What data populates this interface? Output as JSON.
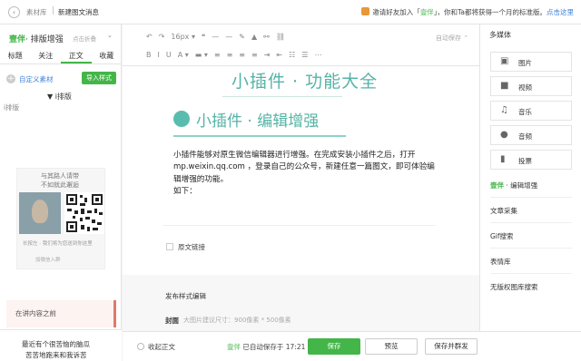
{
  "header": {
    "crumb_back": "素材库",
    "crumb_current": "新建图文消息",
    "invite_prefix": "邀请好友加入「",
    "invite_brand": "壹伴",
    "invite_suffix": "」，你和Ta都将获得一个月的标准版。",
    "invite_link": "点击这里"
  },
  "left": {
    "plugin_brand": "壹伴",
    "plugin_title": "· 排版增强",
    "plugin_fold": "点击折叠",
    "tabs": [
      "标题",
      "关注",
      "正文",
      "收藏"
    ],
    "active_tab": 2,
    "custom_material": "自定义素材",
    "import_button": "导入样式",
    "layout_head": "▼ i排版",
    "layout_sub": "i排版",
    "qr_line1": "与其路人请带",
    "qr_line2": "不如就此邂逅",
    "qr_caption": "长按左 · 我们将为您送到你这里",
    "qr_caption2": "加微信入群",
    "notice": "在讲内容之前",
    "footer_line1": "最近有个很苦恼的脑瓜",
    "footer_line2": "苦苦地跑来和我诉苦"
  },
  "toolbar": {
    "font_size": "16px",
    "autosave": "自动保存",
    "row1": [
      "↶",
      "↷",
      "16px ▾",
      "❝",
      "—",
      "—",
      "✎",
      "▲",
      "⚯",
      "⛓"
    ],
    "row2": [
      "B",
      "I",
      "U",
      "A ▾",
      "▬ ▾",
      "≡",
      "≡",
      "≡",
      "≡",
      "⇥",
      "⇤",
      "☷",
      "☰",
      "⋯"
    ]
  },
  "editor": {
    "big_title": "小插件 · 功能大全",
    "section_title": "小插件 · 编辑增强",
    "paragraph": [
      "小插件能够对原生微信编辑器进行增强。在完成安装小插件之后，打开",
      "mp.weixin.qq.com ，登录自己的公众号，新建任意一篇图文，即可体验编",
      "辑增强的功能。",
      "如下："
    ],
    "source_link": "原文链接",
    "publish_label": "发布样式编辑",
    "cover_label": "封面",
    "cover_hint": "大图片建议尺寸：900像素 * 500像素"
  },
  "bottom": {
    "collapse_label": "收起正文",
    "saved_brand": "壹伴",
    "saved_text": " 已自动保存于 17:21",
    "save_button": "保存",
    "preview_button": "预览",
    "save_send_button": "保存并群发"
  },
  "right": {
    "media_head": "多媒体",
    "media_items": [
      {
        "label": "图片",
        "icon": "image-icon",
        "glyph": "▣"
      },
      {
        "label": "视频",
        "icon": "video-icon",
        "glyph": "■"
      },
      {
        "label": "音乐",
        "icon": "music-icon",
        "glyph": "♫"
      },
      {
        "label": "音频",
        "icon": "mic-icon",
        "glyph": "●"
      },
      {
        "label": "投票",
        "icon": "chart-icon",
        "glyph": "▮"
      }
    ],
    "tool_brand": "壹伴",
    "tool_title": " · 编辑增强",
    "tools": [
      "文章采集",
      "Gif搜索",
      "表情库",
      "无版权图库搜索"
    ]
  },
  "colors": {
    "brand_green": "#44b549",
    "accent_teal": "#55b3a6",
    "link_blue": "#3a7fd5"
  }
}
